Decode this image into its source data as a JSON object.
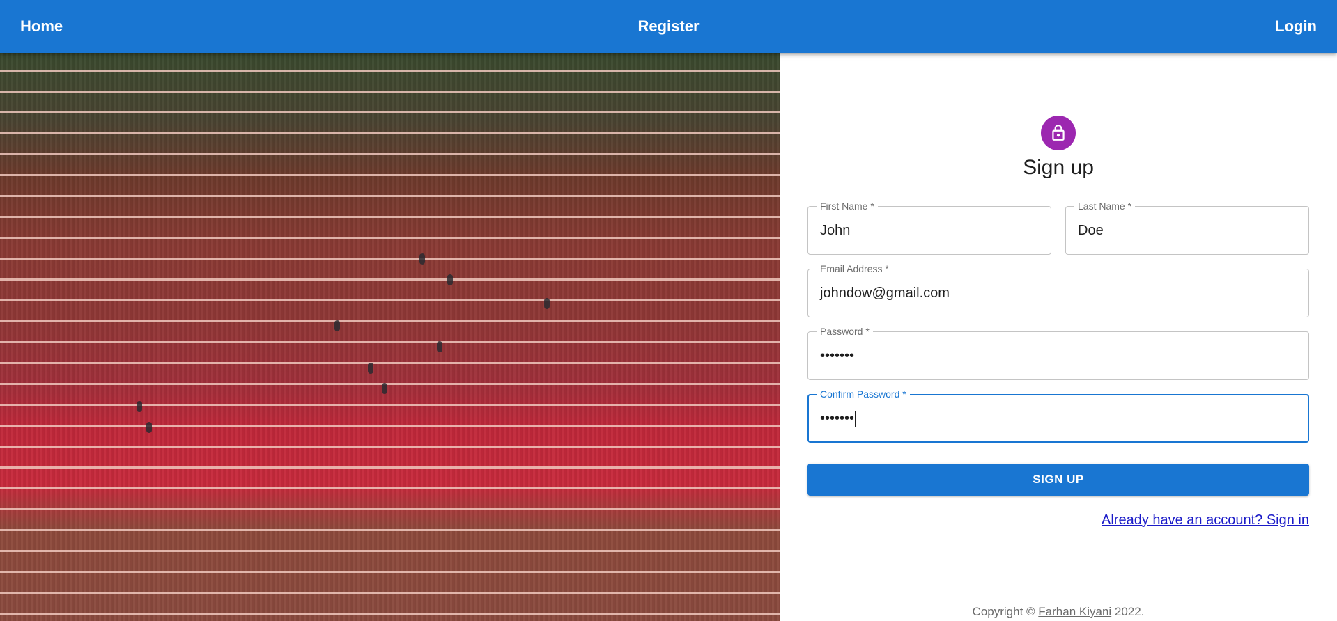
{
  "nav": {
    "home": "Home",
    "register": "Register",
    "login": "Login"
  },
  "form": {
    "icon": "lock-icon",
    "title": "Sign up",
    "fields": {
      "first_name": {
        "label": "First Name *",
        "value": "John"
      },
      "last_name": {
        "label": "Last Name *",
        "value": "Doe"
      },
      "email": {
        "label": "Email Address *",
        "value": "johndow@gmail.com"
      },
      "password": {
        "label": "Password *",
        "value": "•••••••"
      },
      "confirm_password": {
        "label": "Confirm Password *",
        "value": "•••••••"
      }
    },
    "submit_label": "SIGN UP",
    "signin_link": "Already have an account? Sign in"
  },
  "footer": {
    "prefix": "Copyright © ",
    "author": "Farhan Kiyani",
    "suffix": " 2022."
  },
  "colors": {
    "primary": "#1976d2",
    "avatar": "#9c27b0"
  }
}
